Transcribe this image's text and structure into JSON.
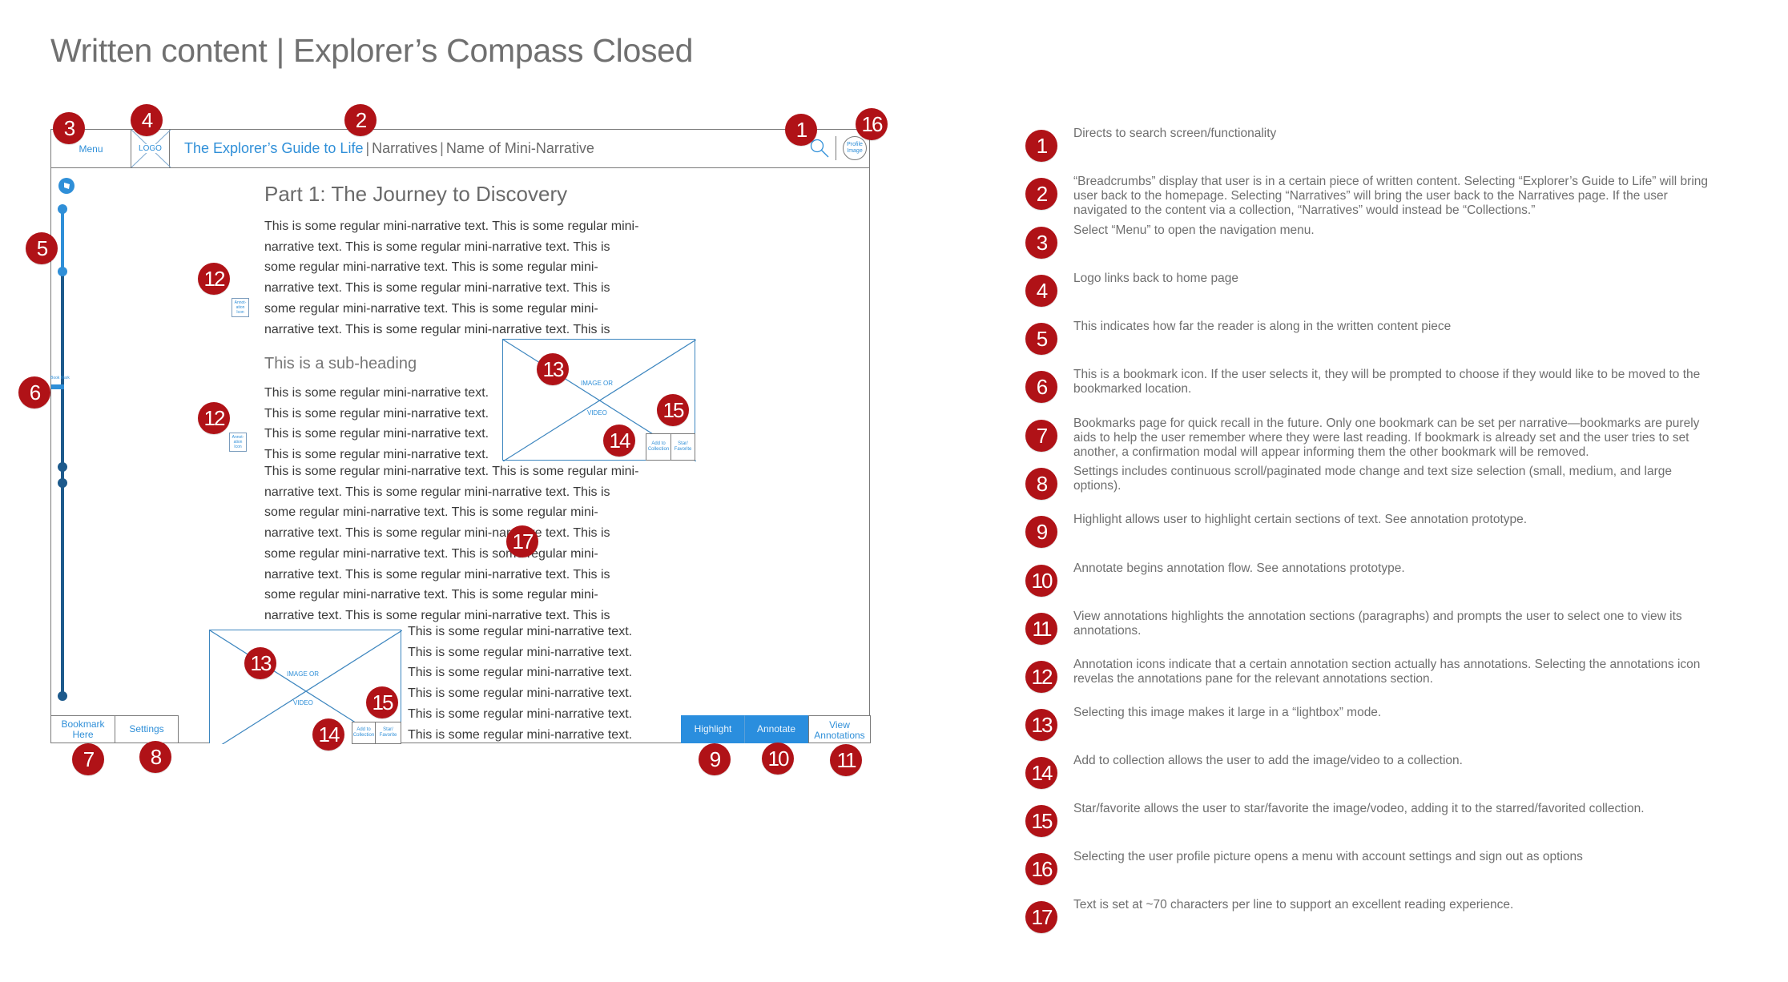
{
  "page_title": "Written content | Explorer’s Compass Closed",
  "wireframe": {
    "header": {
      "menu_label": "Menu",
      "logo_label": "LOGO",
      "breadcrumb": [
        "The Explorer’s Guide to Life",
        "Narratives",
        "Name of Mini-Narrative"
      ],
      "breadcrumb_separator": "|",
      "search_icon": "search-icon",
      "profile_label": "Profile Image"
    },
    "progress": {
      "icon": "compass-icon",
      "read_fraction": 0.13,
      "bookmark_label": "Book Mark"
    },
    "content": {
      "heading": "Part 1: The Journey to Discovery",
      "para1_lines": [
        "This is some regular mini-narrative text. This is some regular mini-",
        "narrative text. This is some regular mini-narrative text. This is",
        "some regular mini-narrative text. This is some regular mini-",
        "narrative text. This is some regular mini-narrative text. This is",
        "some regular mini-narrative text. This is some regular mini-",
        "narrative text. This is some regular mini-narrative text. This is"
      ],
      "subheading": "This is a sub-heading",
      "para2_lines": [
        "This is some regular mini-narrative text.",
        "This is some regular mini-narrative text.",
        "This is some regular mini-narrative text.",
        "This is some regular mini-narrative text."
      ],
      "para3_lines": [
        "This is some regular mini-narrative text. This is some regular mini-",
        "narrative text. This is some regular mini-narrative text. This is",
        "some regular mini-narrative text. This is some regular mini-",
        "narrative text. This is some regular mini-narrative text. This is",
        "some regular mini-narrative text. This is some regular mini-",
        "narrative text. This is some regular mini-narrative text. This is",
        "some regular mini-narrative text. This is some regular mini-",
        "narrative text. This is some regular mini-narrative text. This is"
      ],
      "para4_lines": [
        "This is some regular mini-narrative text.",
        "This is some regular mini-narrative text.",
        "This is some regular mini-narrative text.",
        "This is some regular mini-narrative text.",
        "This is some regular mini-narrative text.",
        "This is some regular mini-narrative text."
      ],
      "annotation_icon_label": "Annot-ation Icon",
      "media": {
        "label_top": "IMAGE OR",
        "label_bottom": "VIDEO",
        "add_to_collection": "Add to Collection",
        "star_favorite": "Star/ Favorite"
      }
    },
    "footer": {
      "bookmark_here": "Bookmark Here",
      "settings": "Settings",
      "highlight": "Highlight",
      "annotate": "Annotate",
      "view_annotations": "View Annotations"
    }
  },
  "callouts": [
    "1",
    "2",
    "3",
    "4",
    "5",
    "6",
    "7",
    "8",
    "9",
    "10",
    "11",
    "12",
    "13",
    "14",
    "15",
    "16",
    "17"
  ],
  "legend": [
    {
      "n": "1",
      "text": "Directs to search screen/functionality"
    },
    {
      "n": "2",
      "text": "“Breadcrumbs” display that user is in a certain piece of written content. Selecting “Explorer’s Guide to Life” will bring user back to the homepage. Selecting “Narratives” will bring the user back to the Narratives page. If the user navigated to the content via a collection, “Narratives” would instead be “Collections.”"
    },
    {
      "n": "3",
      "text": "Select “Menu” to open the navigation menu."
    },
    {
      "n": "4",
      "text": "Logo links back to home page"
    },
    {
      "n": "5",
      "text": "This indicates how far the reader is along in the written content piece"
    },
    {
      "n": "6",
      "text": "This is a bookmark icon. If the user selects it, they will be prompted to choose if they would like to be moved to the bookmarked location."
    },
    {
      "n": "7",
      "text": "Bookmarks page for quick recall in the future. Only one bookmark can be set per narrative—bookmarks are purely aids to help the user remember where they were last reading. If bookmark is already set and the user tries to set another, a confirmation modal will appear informing them the other bookmark will be removed."
    },
    {
      "n": "8",
      "text": "Settings includes continuous scroll/paginated mode change and text size selection (small, medium, and large options)."
    },
    {
      "n": "9",
      "text": "Highlight allows user to highlight certain sections of text. See annotation prototype."
    },
    {
      "n": "10",
      "text": "Annotate begins annotation flow. See annotations prototype."
    },
    {
      "n": "11",
      "text": "View annotations highlights the annotation sections (paragraphs) and prompts the user to select one to view its annotations."
    },
    {
      "n": "12",
      "text": "Annotation icons indicate that a certain annotation section actually has annotations. Selecting the annotations icon revelas the annotations pane for the relevant annotations section."
    },
    {
      "n": "13",
      "text": "Selecting this image makes it large in a “lightbox” mode."
    },
    {
      "n": "14",
      "text": "Add to collection allows the user to add the image/video to a collection."
    },
    {
      "n": "15",
      "text": "Star/favorite allows the user to star/favorite the image/vodeo, adding it to the starred/favorited collection."
    },
    {
      "n": "16",
      "text": "Selecting the user profile picture opens a menu with account settings and sign out as options"
    },
    {
      "n": "17",
      "text": "Text is set at ~70 characters per line to support an excellent reading experience."
    }
  ],
  "colors": {
    "callout_red": "#b01217",
    "accent_blue": "#2a8ede",
    "progress_dark": "#1d5a8c",
    "wire_gray": "#7a7a7a"
  }
}
